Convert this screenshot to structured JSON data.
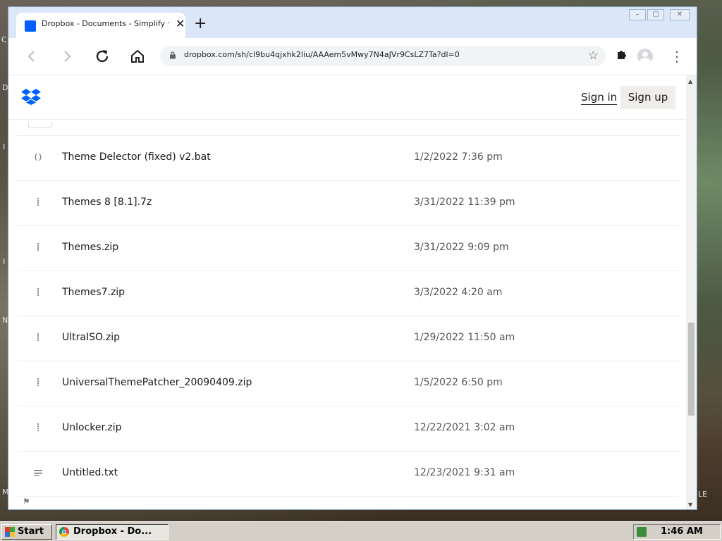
{
  "desktop": {
    "edge_chars": [
      "C",
      "D",
      "I",
      "I",
      "N",
      "M",
      "LE"
    ]
  },
  "browser": {
    "tab_title": "Dropbox - Documents - Simplify your",
    "tab_close": "✕",
    "new_tab": "+",
    "window_controls": [
      "–",
      "▢",
      "✕"
    ],
    "url": "dropbox.com/sh/cl9bu4qjxhk2liu/AAAem5vMwy7N4aJVr9CsLZ7Ta?dl=0",
    "icons": {
      "back": "back-arrow-icon",
      "forward": "forward-arrow-icon",
      "reload": "reload-icon",
      "home": "home-icon",
      "lock": "lock-icon",
      "star": "star-icon",
      "extensions": "puzzle-icon",
      "profile": "profile-icon",
      "menu": "kebab-menu-icon"
    }
  },
  "page": {
    "brand_color": "#0061fe",
    "sign_in": "Sign in",
    "sign_up": "Sign up",
    "files": [
      {
        "name": "Theme Delector (fixed) v2.bat",
        "date": "1/2/2022 7:36 pm",
        "icon": "code"
      },
      {
        "name": "Themes 8 [8.1].7z",
        "date": "3/31/2022 11:39 pm",
        "icon": "zip"
      },
      {
        "name": "Themes.zip",
        "date": "3/31/2022 9:09 pm",
        "icon": "zip"
      },
      {
        "name": "Themes7.zip",
        "date": "3/3/2022 4:20 am",
        "icon": "zip"
      },
      {
        "name": "UltraISO.zip",
        "date": "1/29/2022 11:50 am",
        "icon": "zip"
      },
      {
        "name": "UniversalThemePatcher_20090409.zip",
        "date": "1/5/2022 6:50 pm",
        "icon": "zip"
      },
      {
        "name": "Unlocker.zip",
        "date": "12/22/2021 3:02 am",
        "icon": "zip"
      },
      {
        "name": "Untitled.txt",
        "date": "12/23/2021 9:31 am",
        "icon": "text"
      }
    ],
    "code_glyph": "{}"
  },
  "taskbar": {
    "start": "Start",
    "task": "Dropbox - Do...",
    "clock": "1:46 AM"
  }
}
